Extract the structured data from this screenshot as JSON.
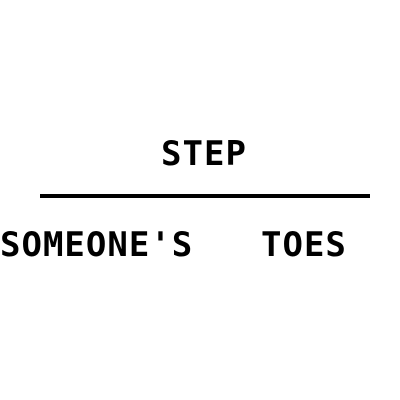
{
  "puzzle": {
    "top_word": "STEP",
    "bottom_words": [
      "SOMEONE'S",
      "TOES"
    ]
  },
  "colors": {
    "background": "#ffffff",
    "text": "#000000",
    "divider": "#000000"
  }
}
